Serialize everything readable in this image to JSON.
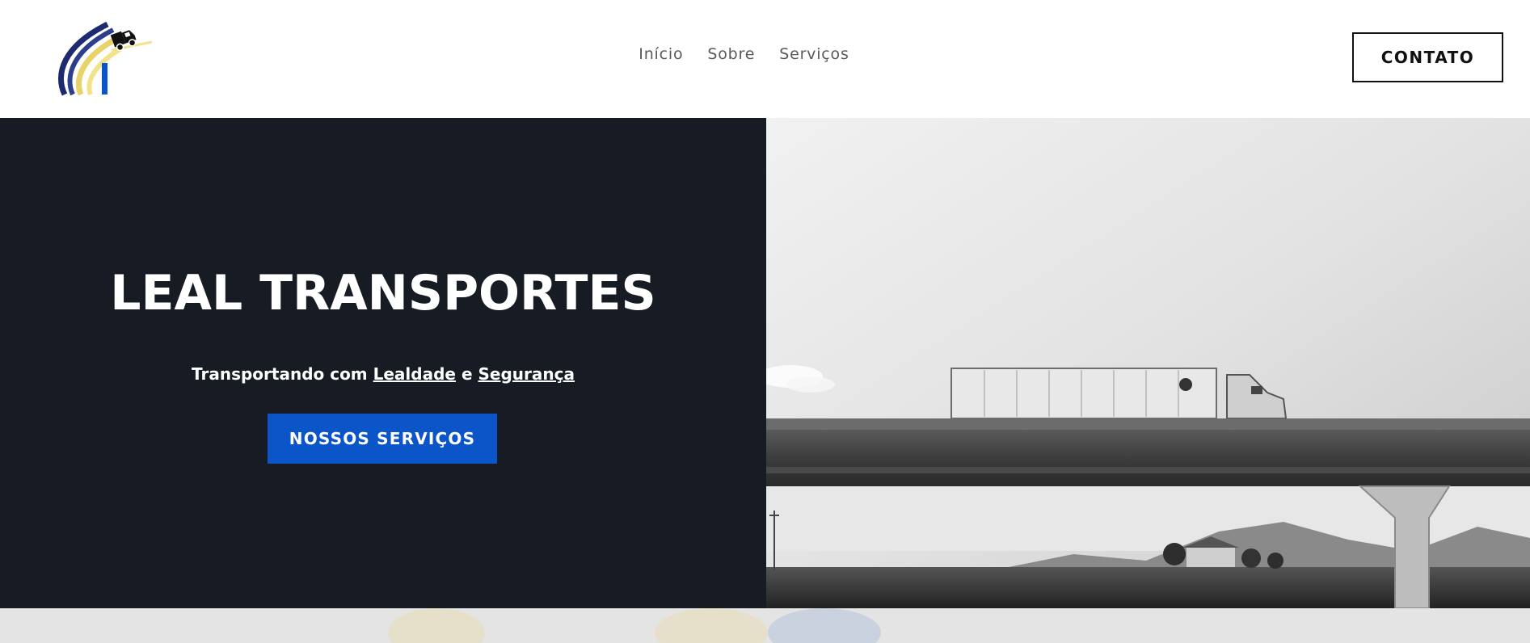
{
  "header": {
    "nav": [
      {
        "label": "Início"
      },
      {
        "label": "Sobre"
      },
      {
        "label": "Serviços"
      }
    ],
    "contact_label": "CONTATO"
  },
  "hero": {
    "title": "LEAL TRANSPORTES",
    "subtitle_prefix": "Transportando com ",
    "subtitle_word1": "Lealdade",
    "subtitle_mid": " e ",
    "subtitle_word2": "Segurança",
    "cta_label": "NOSSOS SERVIÇOS"
  },
  "colors": {
    "hero_bg": "#171c24",
    "cta_bg": "#0b55c8",
    "nav_text": "#5a5a5a",
    "bottom_strip": "#e4e4e4"
  },
  "icons": {
    "logo": "truck-swoosh-logo"
  }
}
